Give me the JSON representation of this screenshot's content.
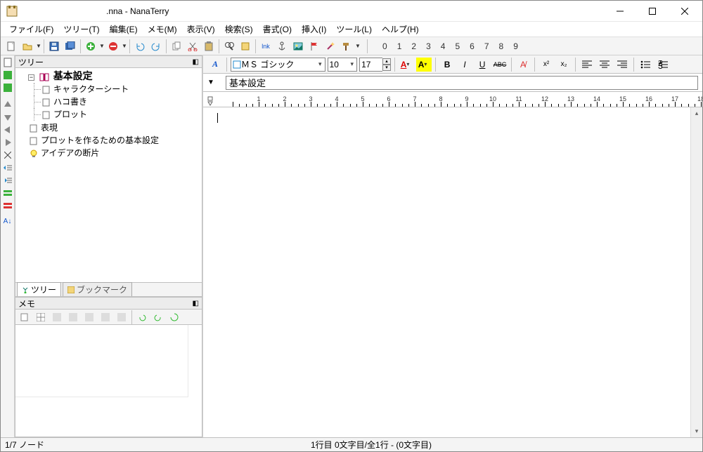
{
  "title": ".nna - NanaTerry",
  "menu": {
    "file": "ファイル(F)",
    "tree": "ツリー(T)",
    "edit": "編集(E)",
    "memo": "メモ(M)",
    "view": "表示(V)",
    "search": "検索(S)",
    "format": "書式(O)",
    "insert": "挿入(I)",
    "tool": "ツール(L)",
    "help": "ヘルプ(H)"
  },
  "numbers": [
    "0",
    "1",
    "2",
    "3",
    "4",
    "5",
    "6",
    "7",
    "8",
    "9"
  ],
  "tree_panel": {
    "header": "ツリー",
    "nodes": {
      "root": "基本設定",
      "children": [
        "キャラクターシート",
        "ハコ書き",
        "プロット"
      ],
      "siblings": [
        "表現",
        "プロットを作るための基本設定",
        "アイデアの断片"
      ]
    },
    "tabs": {
      "tree": "ツリー",
      "bookmark": "ブックマーク"
    }
  },
  "memo_panel": {
    "header": "メモ"
  },
  "editor": {
    "font_name": "ＭＳ ゴシック",
    "font_size": "10",
    "line_height": "17",
    "title": "基本設定"
  },
  "ruler_labels": [
    "1",
    "2",
    "3",
    "4",
    "5",
    "6",
    "7",
    "8",
    "9",
    "10",
    "11",
    "12",
    "13",
    "14",
    "15",
    "16",
    "17",
    "18"
  ],
  "status": {
    "left": "1/7 ノード",
    "center": "1行目 0文字目/全1行 -   (0文字目)"
  },
  "icons": {
    "bold": "B",
    "italic": "I",
    "underline": "U",
    "strike": "ABC",
    "a_tool": "A"
  }
}
